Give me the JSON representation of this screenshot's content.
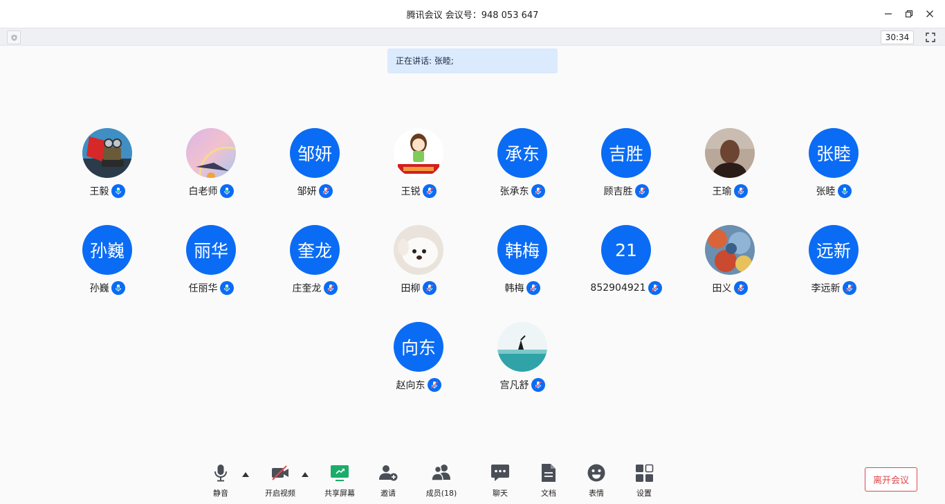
{
  "window": {
    "title": "腾讯会议 会议号：948 053 647"
  },
  "infobar": {
    "timer": "30:34"
  },
  "speaking": {
    "text": "正在讲话: 张睦;"
  },
  "participants": [
    {
      "name": "王毅",
      "avatar_type": "photo",
      "avatar_icon": "robot-photo-icon",
      "mic": "speaking"
    },
    {
      "name": "白老师",
      "avatar_type": "photo",
      "avatar_icon": "rainbow-photo-icon",
      "mic": "speaking"
    },
    {
      "name": "邹妍",
      "avatar_type": "initial",
      "initial": "邹妍",
      "mic": "muted"
    },
    {
      "name": "王锐",
      "avatar_type": "photo",
      "avatar_icon": "cartoon-girl-photo-icon",
      "mic": "muted"
    },
    {
      "name": "张承东",
      "avatar_type": "initial",
      "initial": "承东",
      "mic": "muted"
    },
    {
      "name": "顾吉胜",
      "avatar_type": "initial",
      "initial": "吉胜",
      "mic": "muted"
    },
    {
      "name": "王瑜",
      "avatar_type": "photo",
      "avatar_icon": "man-photo-icon",
      "mic": "muted"
    },
    {
      "name": "张睦",
      "avatar_type": "initial",
      "initial": "张睦",
      "mic": "speaking"
    },
    {
      "name": "孙巍",
      "avatar_type": "initial",
      "initial": "孙巍",
      "mic": "speaking"
    },
    {
      "name": "任丽华",
      "avatar_type": "initial",
      "initial": "丽华",
      "mic": "speaking"
    },
    {
      "name": "庄奎龙",
      "avatar_type": "initial",
      "initial": "奎龙",
      "mic": "muted"
    },
    {
      "name": "田柳",
      "avatar_type": "photo",
      "avatar_icon": "puppy-photo-icon",
      "mic": "muted"
    },
    {
      "name": "韩梅",
      "avatar_type": "initial",
      "initial": "韩梅",
      "mic": "muted"
    },
    {
      "name": "852904921",
      "avatar_type": "initial",
      "initial": "21",
      "mic": "muted"
    },
    {
      "name": "田义",
      "avatar_type": "photo",
      "avatar_icon": "painting-photo-icon",
      "mic": "muted"
    },
    {
      "name": "李远新",
      "avatar_type": "initial",
      "initial": "远新",
      "mic": "muted"
    },
    {
      "name": "赵向东",
      "avatar_type": "initial",
      "initial": "向东",
      "mic": "muted"
    },
    {
      "name": "宫凡舒",
      "avatar_type": "photo",
      "avatar_icon": "sea-photo-icon",
      "mic": "muted"
    }
  ],
  "toolbar": {
    "mute": "静音",
    "video": "开启视频",
    "share": "共享屏幕",
    "invite": "邀请",
    "members": "成员(18)",
    "chat": "聊天",
    "docs": "文档",
    "reactions": "表情",
    "settings": "设置",
    "leave": "离开会议"
  },
  "colors": {
    "accent": "#0a6cf5",
    "share_green": "#1aad6a",
    "danger": "#e0464a",
    "speaking_banner": "#dbeafd"
  }
}
